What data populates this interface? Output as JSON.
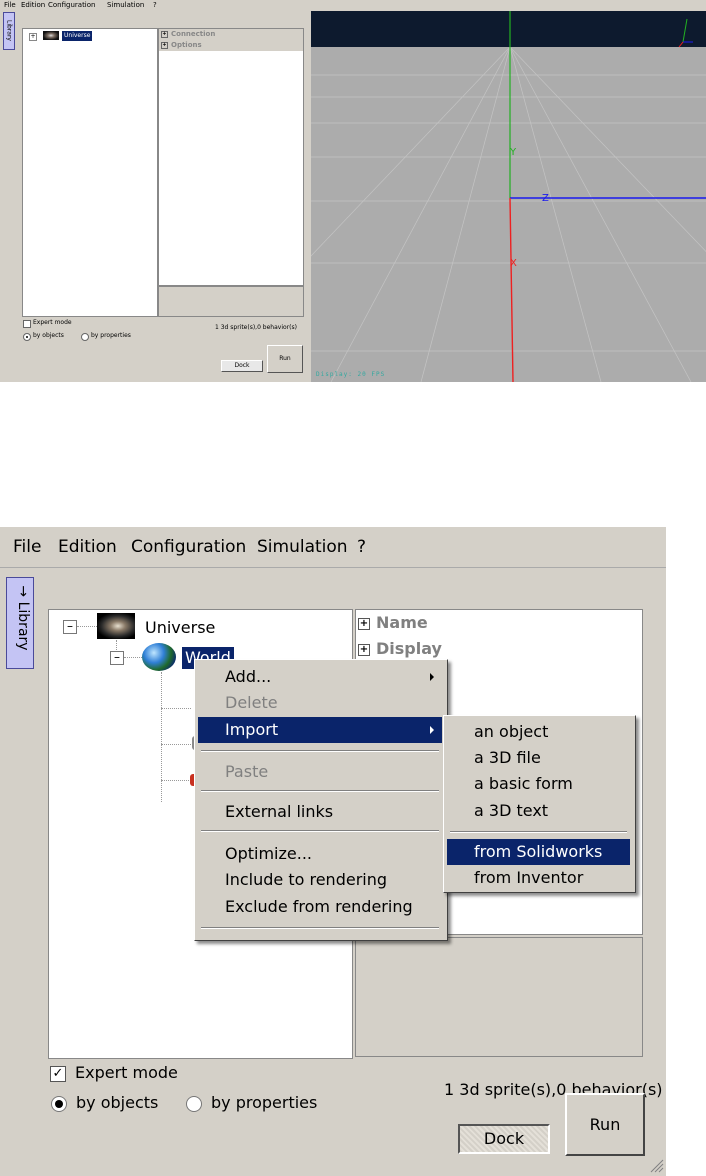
{
  "shot1": {
    "menu": [
      "File",
      "Edition",
      "Configuration",
      "Simulation",
      "?"
    ],
    "library_tab": "Library",
    "tree_root": "Universe",
    "props_headers": [
      "Connection",
      "Options"
    ],
    "expert_mode": "Expert mode",
    "by_objects": "by objects",
    "by_properties": "by properties",
    "status": "1 3d sprite(s),0 behavior(s)",
    "dock": "Dock",
    "run": "Run",
    "viewport": {
      "axis_y": "Y",
      "axis_z": "Z",
      "axis_x": "X",
      "fps": "Display: 20 FPS",
      "colors": {
        "y": "#22b022",
        "z": "#1a1aee",
        "x": "#ee2020",
        "sky": "#0d1a2e",
        "floor": "#acacac"
      }
    }
  },
  "shot2": {
    "menu": [
      "File",
      "Edition",
      "Configuration",
      "Simulation",
      "?"
    ],
    "library_tab": "Library",
    "tree": {
      "root": "Universe",
      "world": "World"
    },
    "props_headers": [
      "Name",
      "Display"
    ],
    "context_menu": {
      "add": "Add...",
      "delete": "Delete",
      "import": "Import",
      "paste": "Paste",
      "external_links": "External links",
      "optimize": "Optimize...",
      "include": "Include to rendering",
      "exclude": "Exclude from rendering"
    },
    "import_submenu": {
      "object": "an object",
      "file3d": "a 3D file",
      "basic_form": "a basic form",
      "text3d": "a 3D text",
      "solidworks": "from Solidworks",
      "inventor": "from Inventor"
    },
    "expert_mode": "Expert mode",
    "expert_checked": true,
    "by_objects": "by objects",
    "by_properties": "by properties",
    "status": "1 3d sprite(s),0 behavior(s)",
    "dock": "Dock",
    "run": "Run",
    "selection_color": "#0a246a"
  }
}
